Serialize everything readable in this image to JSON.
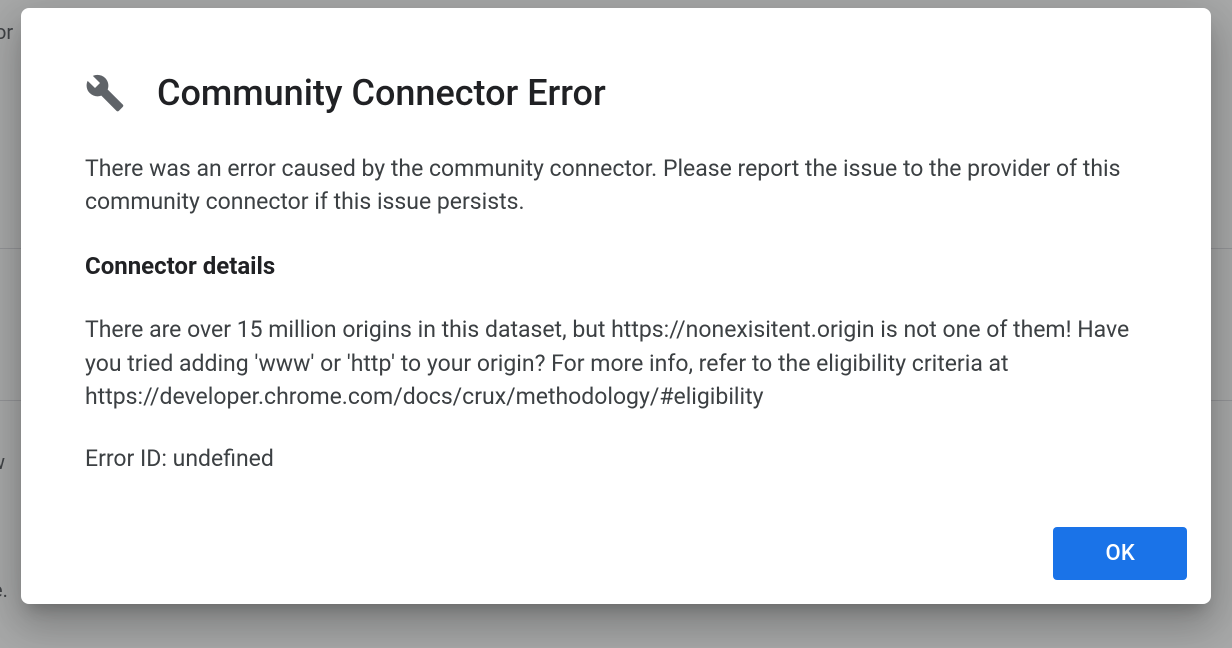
{
  "modal": {
    "title": "Community Connector Error",
    "intro": "There was an error caused by the community connector. Please report the issue to the provider of this community connector if this issue persists.",
    "subheading": "Connector details",
    "detail": "There are over 15 million origins in this dataset, but https://nonexisitent.origin is not one of them! Have you tried adding 'www' or 'http' to your origin? For more info, refer to the eligibility criteria at https://developer.chrome.com/docs/crux/methodology/#eligibility",
    "error_id_label": "Error ID: undefined",
    "ok_label": "OK"
  },
  "backdrop": {
    "t1": "or",
    "t2": "r",
    "t3": "w",
    "t4": "e."
  }
}
